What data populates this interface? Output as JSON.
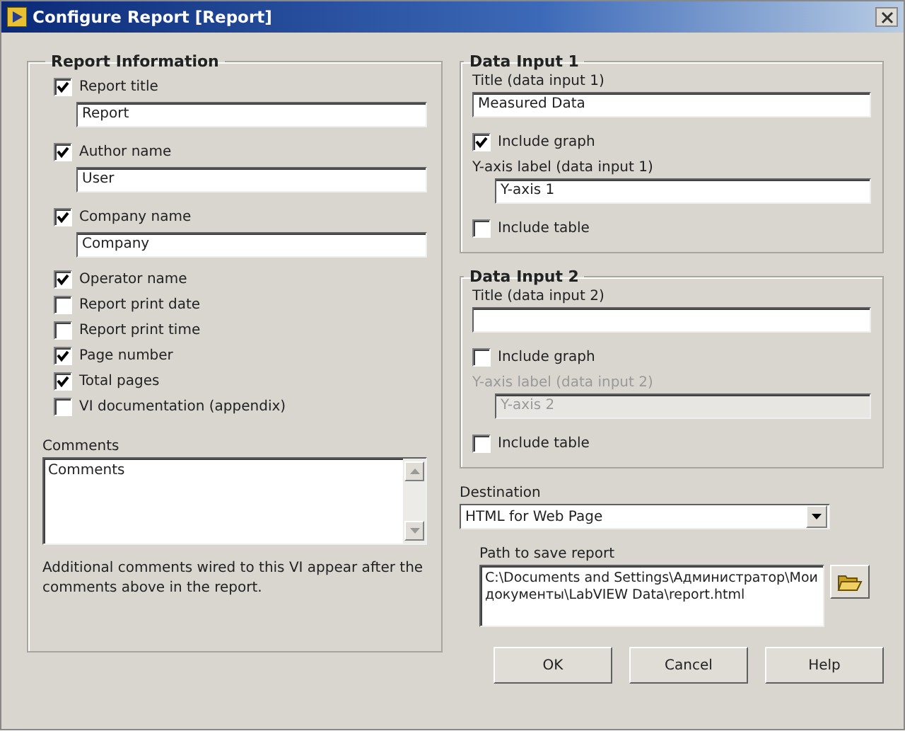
{
  "window": {
    "title": "Configure Report [Report]"
  },
  "report_information": {
    "title": "Report Information",
    "items": [
      {
        "kind": "checkbox_field",
        "label": "Report title",
        "checked": true,
        "value": "Report"
      },
      {
        "kind": "checkbox_field",
        "label": "Author name",
        "checked": true,
        "value": "User"
      },
      {
        "kind": "checkbox_field",
        "label": "Company name",
        "checked": true,
        "value": "Company"
      },
      {
        "kind": "checkbox",
        "label": "Operator name",
        "checked": true
      },
      {
        "kind": "checkbox",
        "label": "Report print date",
        "checked": false
      },
      {
        "kind": "checkbox",
        "label": "Report print time",
        "checked": false
      },
      {
        "kind": "checkbox",
        "label": "Page number",
        "checked": true
      },
      {
        "kind": "checkbox",
        "label": "Total pages",
        "checked": true
      },
      {
        "kind": "checkbox",
        "label": "VI documentation (appendix)",
        "checked": false
      }
    ],
    "comments": {
      "label": "Comments",
      "value": "Comments"
    },
    "note": "Additional comments wired to this VI appear after the comments above in the report."
  },
  "data_inputs": [
    {
      "title": "Data Input 1",
      "title_label": "Title (data input 1)",
      "title_value": "Measured Data",
      "include_graph": {
        "label": "Include graph",
        "checked": true
      },
      "y_axis": {
        "label": "Y-axis label (data input 1)",
        "value": "Y-axis 1",
        "disabled": false
      },
      "include_table": {
        "label": "Include table",
        "checked": false
      }
    },
    {
      "title": "Data Input 2",
      "title_label": "Title (data input 2)",
      "include_graph": {
        "label": "Include graph",
        "checked": false
      },
      "y_axis": {
        "label": "Y-axis label (data input 2)",
        "value": "Y-axis 2",
        "disabled": true
      },
      "include_table": {
        "label": "Include table",
        "checked": false
      }
    }
  ],
  "destination": {
    "label": "Destination",
    "value": "HTML for Web Page"
  },
  "path": {
    "label": "Path to save report",
    "value": "C:\\Documents and Settings\\Администратор\\Мои документы\\LabVIEW Data\\report.html"
  },
  "buttons": [
    "OK",
    "Cancel",
    "Help"
  ]
}
